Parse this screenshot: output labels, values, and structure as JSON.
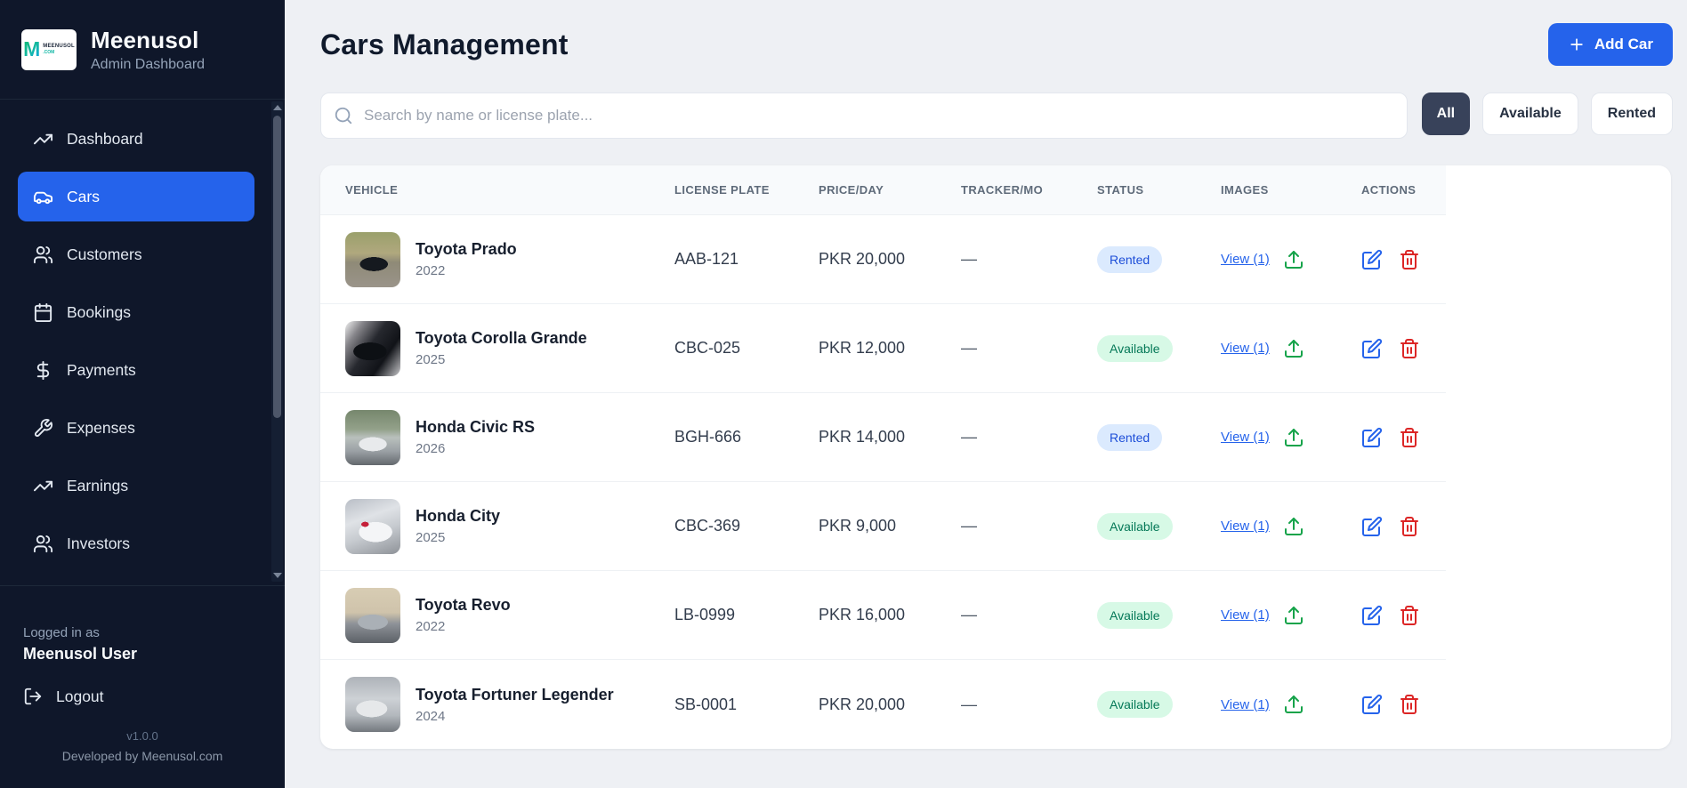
{
  "sidebar": {
    "brand": {
      "logo_mark": "M",
      "logo_text": "MEENUSOL",
      "logo_sub": ".COM",
      "name": "Meenusol",
      "subtitle": "Admin Dashboard"
    },
    "nav": [
      {
        "label": "Dashboard",
        "icon": "trending-up-icon",
        "active": false
      },
      {
        "label": "Cars",
        "icon": "car-icon",
        "active": true
      },
      {
        "label": "Customers",
        "icon": "users-icon",
        "active": false
      },
      {
        "label": "Bookings",
        "icon": "calendar-icon",
        "active": false
      },
      {
        "label": "Payments",
        "icon": "dollar-icon",
        "active": false
      },
      {
        "label": "Expenses",
        "icon": "wrench-icon",
        "active": false
      },
      {
        "label": "Earnings",
        "icon": "trending-up-icon",
        "active": false
      },
      {
        "label": "Investors",
        "icon": "users-icon",
        "active": false
      }
    ],
    "footer": {
      "logged_in_label": "Logged in as",
      "user_name": "Meenusol User",
      "logout_label": "Logout",
      "version": "v1.0.0",
      "developed_by": "Developed by Meenusol.com"
    }
  },
  "header": {
    "title": "Cars Management",
    "add_button": "Add Car"
  },
  "controls": {
    "search_placeholder": "Search by name or license plate...",
    "filters": [
      {
        "label": "All",
        "active": true
      },
      {
        "label": "Available",
        "active": false
      },
      {
        "label": "Rented",
        "active": false
      }
    ]
  },
  "table": {
    "columns": [
      "VEHICLE",
      "LICENSE PLATE",
      "PRICE/DAY",
      "TRACKER/MO",
      "STATUS",
      "IMAGES",
      "ACTIONS"
    ],
    "rows": [
      {
        "name": "Toyota Prado",
        "year": "2022",
        "plate": "AAB-121",
        "price": "PKR 20,000",
        "tracker": "—",
        "status": "Rented",
        "images_link": "View (1)"
      },
      {
        "name": "Toyota Corolla Grande",
        "year": "2025",
        "plate": "CBC-025",
        "price": "PKR 12,000",
        "tracker": "—",
        "status": "Available",
        "images_link": "View (1)"
      },
      {
        "name": "Honda Civic RS",
        "year": "2026",
        "plate": "BGH-666",
        "price": "PKR 14,000",
        "tracker": "—",
        "status": "Rented",
        "images_link": "View (1)"
      },
      {
        "name": "Honda City",
        "year": "2025",
        "plate": "CBC-369",
        "price": "PKR 9,000",
        "tracker": "—",
        "status": "Available",
        "images_link": "View (1)"
      },
      {
        "name": "Toyota Revo",
        "year": "2022",
        "plate": "LB-0999",
        "price": "PKR 16,000",
        "tracker": "—",
        "status": "Available",
        "images_link": "View (1)"
      },
      {
        "name": "Toyota Fortuner Legender",
        "year": "2024",
        "plate": "SB-0001",
        "price": "PKR 20,000",
        "tracker": "—",
        "status": "Available",
        "images_link": "View (1)"
      }
    ]
  },
  "colors": {
    "accent": "#2563eb",
    "sidebar_bg": "#0f172a",
    "main_bg": "#eef0f4",
    "rented_bg": "#dbeafe",
    "rented_text": "#1d4ed8",
    "available_bg": "#d7f9e6",
    "available_text": "#047857",
    "upload_green": "#16a34a",
    "delete_red": "#dc2626",
    "active_filter_bg": "#38425a"
  }
}
